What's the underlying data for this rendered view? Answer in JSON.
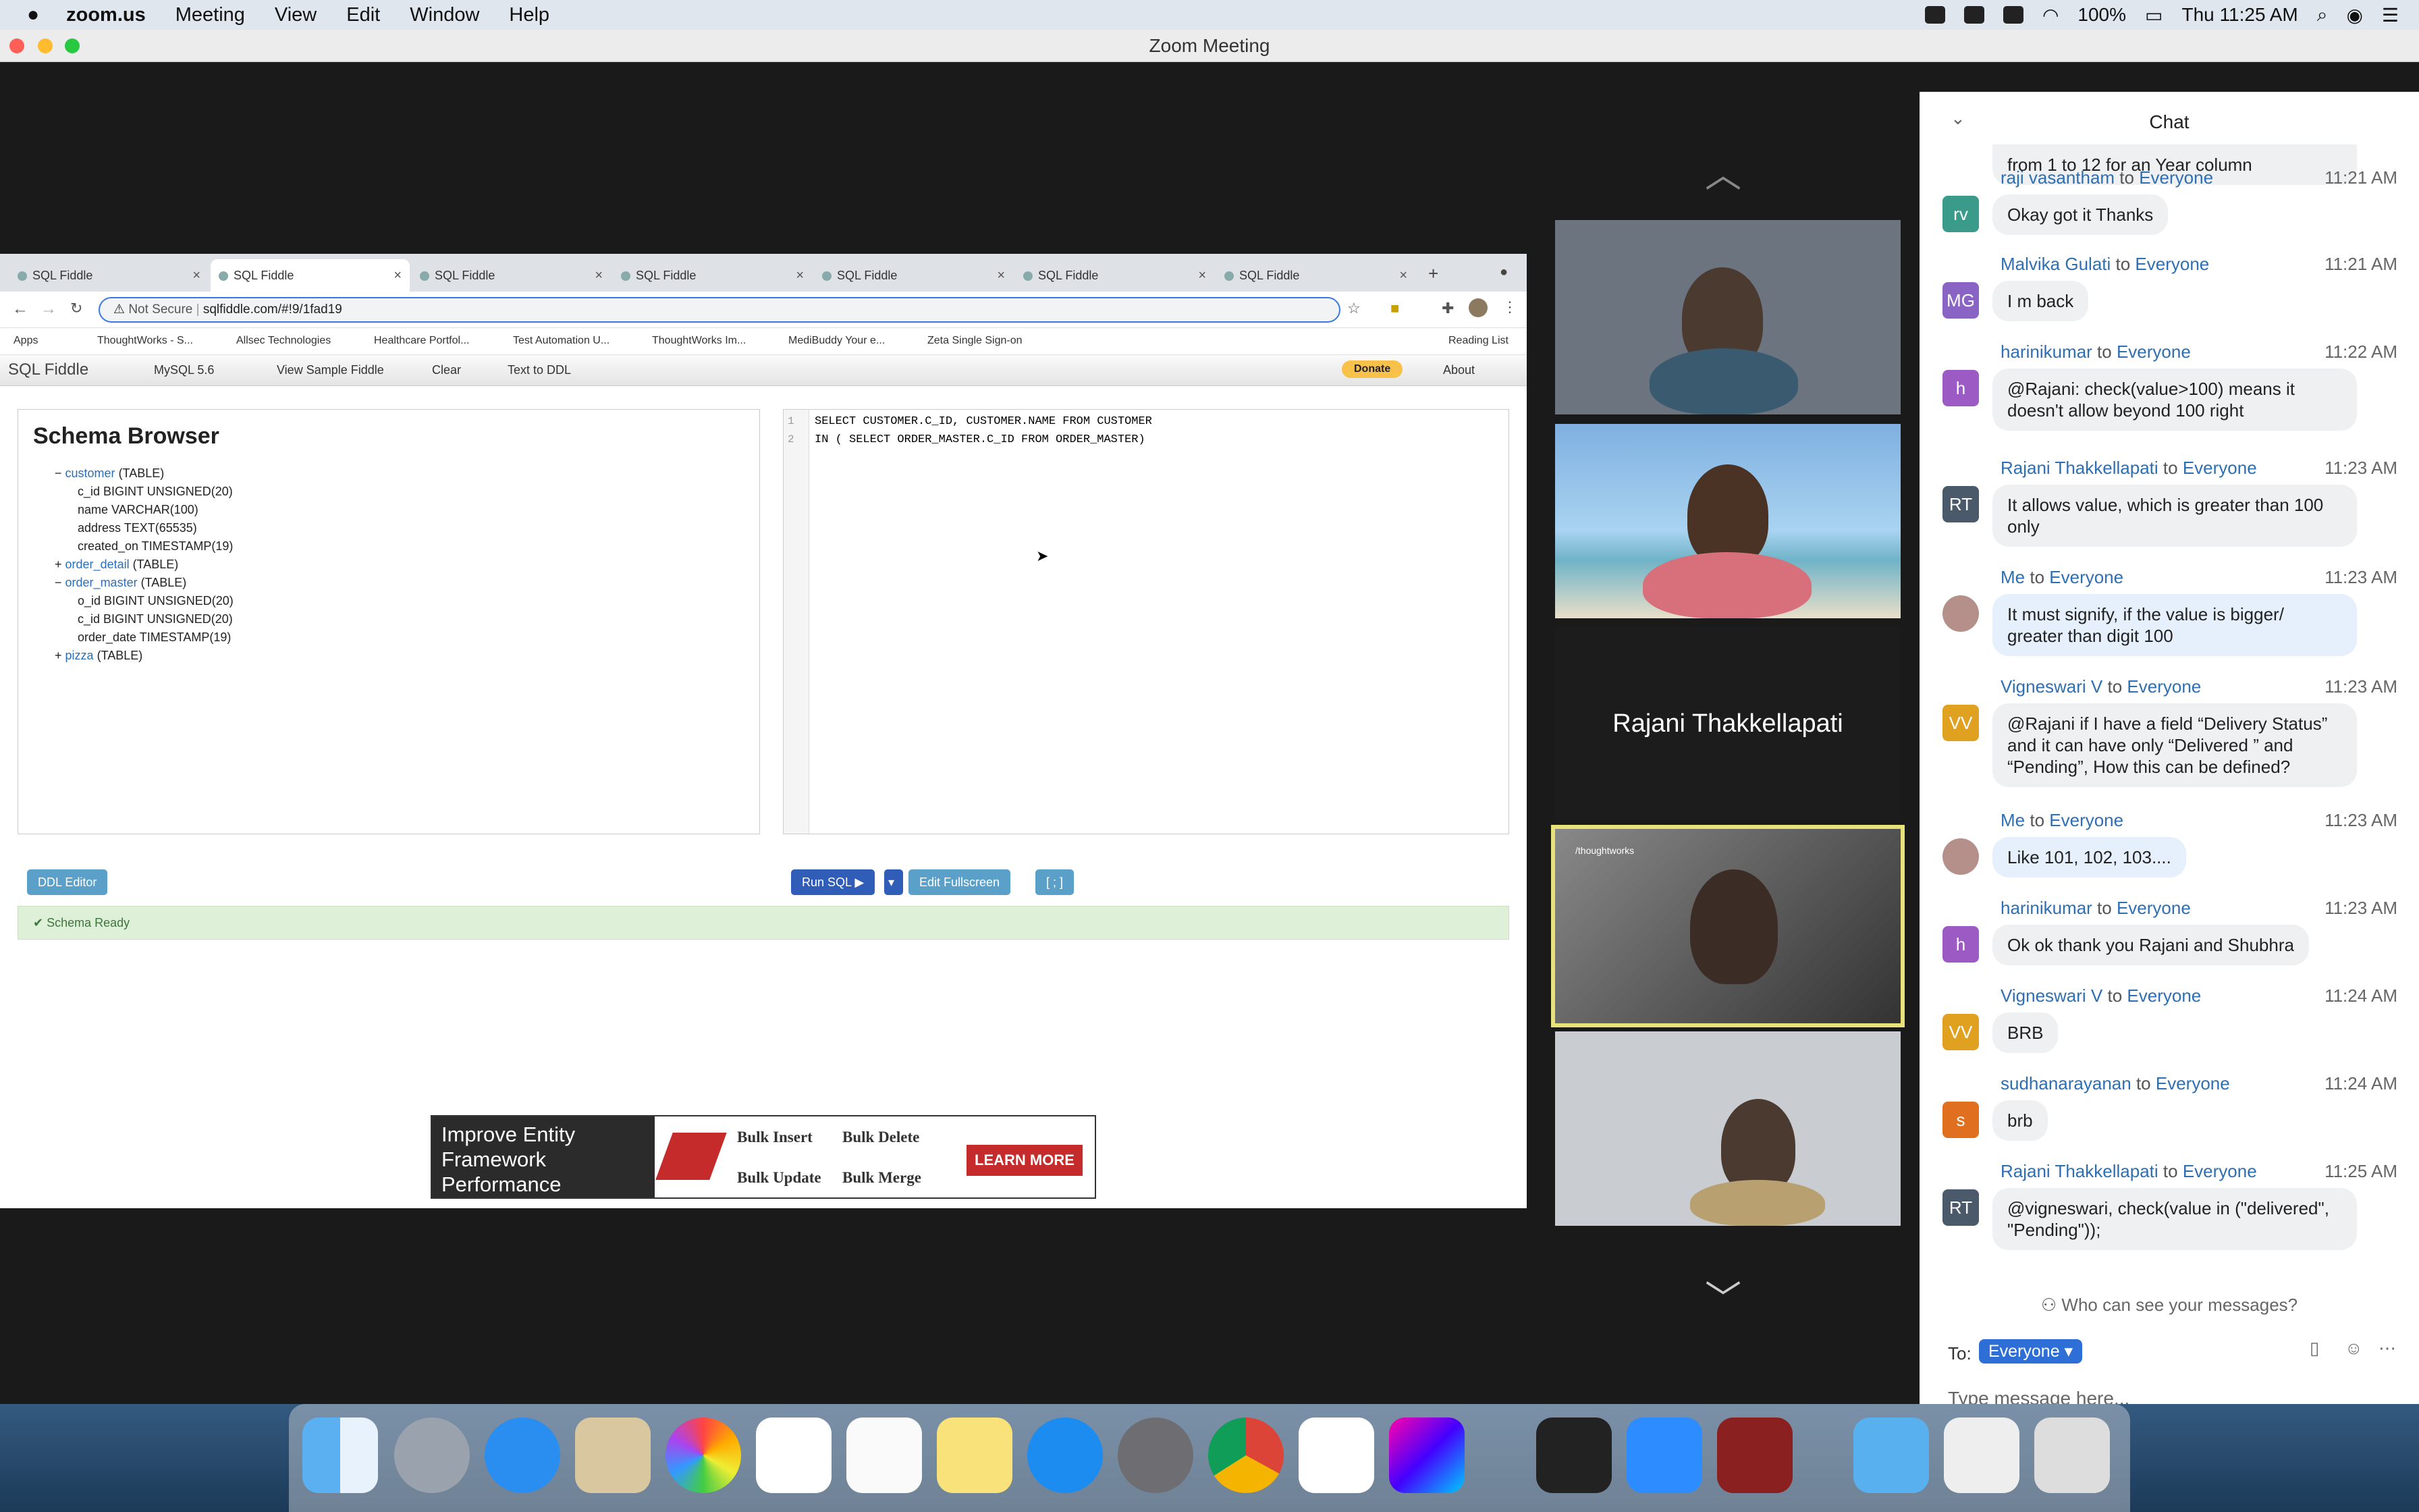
{
  "menubar": {
    "app": "zoom.us",
    "items": [
      "Meeting",
      "View",
      "Edit",
      "Window",
      "Help"
    ],
    "battery": "100%",
    "clock": "Thu 11:25 AM"
  },
  "window": {
    "title": "Zoom Meeting"
  },
  "browser": {
    "tabs": [
      "SQL Fiddle",
      "SQL Fiddle",
      "SQL Fiddle",
      "SQL Fiddle",
      "SQL Fiddle",
      "SQL Fiddle",
      "SQL Fiddle"
    ],
    "not_secure": "Not Secure",
    "url": "sqlfiddle.com/#!9/1fad19",
    "bookmarks": [
      "Apps",
      "ThoughtWorks - S...",
      "Allsec Technologies",
      "Healthcare Portfol...",
      "Test Automation U...",
      "ThoughtWorks Im...",
      "MediBuddy Your e...",
      "Zeta Single Sign-on",
      "Reading List"
    ]
  },
  "fiddle": {
    "logo": "SQL Fiddle",
    "db": "MySQL 5.6",
    "view_sample": "View Sample Fiddle",
    "clear": "Clear",
    "text_to_ddl": "Text to DDL",
    "donate": "Donate",
    "about": "About",
    "schema_title": "Schema Browser",
    "tree": [
      {
        "sign": "−",
        "name": "customer",
        "kind": "(TABLE)",
        "cols": [
          "c_id BIGINT UNSIGNED(20)",
          "name VARCHAR(100)",
          "address TEXT(65535)",
          "created_on TIMESTAMP(19)"
        ]
      },
      {
        "sign": "+",
        "name": "order_detail",
        "kind": "(TABLE)",
        "cols": []
      },
      {
        "sign": "−",
        "name": "order_master",
        "kind": "(TABLE)",
        "cols": [
          "o_id BIGINT UNSIGNED(20)",
          "c_id BIGINT UNSIGNED(20)",
          "order_date TIMESTAMP(19)"
        ]
      },
      {
        "sign": "+",
        "name": "pizza",
        "kind": "(TABLE)",
        "cols": []
      }
    ],
    "code": [
      "SELECT CUSTOMER.C_ID, CUSTOMER.NAME FROM CUSTOMER",
      "IN ( SELECT ORDER_MASTER.C_ID FROM ORDER_MASTER)"
    ],
    "ddl_editor": "DDL Editor",
    "run_sql": "Run SQL ▶",
    "edit_fullscreen": "Edit Fullscreen",
    "sep": "[ ; ]",
    "ready": "✔ Schema Ready"
  },
  "ad": {
    "headline": "Improve Entity Framework Performance",
    "opts": [
      "Bulk Insert",
      "Bulk Delete",
      "Bulk Update",
      "Bulk Merge"
    ],
    "cta": "LEARN MORE"
  },
  "video": {
    "speaker_name": "Rajani Thakkellapati",
    "brand": "/thoughtworks"
  },
  "chat": {
    "title": "Chat",
    "partial": "from 1 to 12 for an Year column",
    "messages": [
      {
        "initials": "rv",
        "color": "#3a9b8a",
        "from": "raji vasantham",
        "to": "Everyone",
        "time": "11:21 AM",
        "text": "Okay got it Thanks"
      },
      {
        "initials": "MG",
        "color": "#8a64c4",
        "from": "Malvika Gulati",
        "to": "Everyone",
        "time": "11:21 AM",
        "text": "I m back"
      },
      {
        "initials": "h",
        "color": "#9c5bc4",
        "from": "harinikumar",
        "to": "Everyone",
        "time": "11:22 AM",
        "text": "@Rajani: check(value>100) means it doesn't allow beyond 100 right"
      },
      {
        "initials": "RT",
        "color": "#4a5a6a",
        "from": "Rajani Thakkellapati",
        "to": "Everyone",
        "time": "11:23 AM",
        "text": "It allows value, which is greater than 100 only"
      },
      {
        "initials": "",
        "color": "#b58f8a",
        "from": "Me",
        "to": "Everyone",
        "time": "11:23 AM",
        "text": "It must signify, if the value is bigger/ greater than digit 100",
        "me": true
      },
      {
        "initials": "VV",
        "color": "#e0a020",
        "from": "Vigneswari V",
        "to": "Everyone",
        "time": "11:23 AM",
        "text": "@Rajani if I have a field “Delivery Status” and it can have only “Delivered ” and “Pending”, How this can be defined?"
      },
      {
        "initials": "",
        "color": "#b58f8a",
        "from": "Me",
        "to": "Everyone",
        "time": "11:23 AM",
        "text": "Like 101, 102, 103....",
        "me": true
      },
      {
        "initials": "h",
        "color": "#9c5bc4",
        "from": "harinikumar",
        "to": "Everyone",
        "time": "11:23 AM",
        "text": "Ok ok thank you Rajani and Shubhra"
      },
      {
        "initials": "VV",
        "color": "#e0a020",
        "from": "Vigneswari V",
        "to": "Everyone",
        "time": "11:24 AM",
        "text": "BRB"
      },
      {
        "initials": "s",
        "color": "#e07020",
        "from": "sudhanarayanan",
        "to": "Everyone",
        "time": "11:24 AM",
        "text": "brb"
      },
      {
        "initials": "RT",
        "color": "#4a5a6a",
        "from": "Rajani Thakkellapati",
        "to": "Everyone",
        "time": "11:25 AM",
        "text": "@vigneswari,  check(value in (\"delivered\", \"Pending\"));"
      }
    ],
    "who_can_see": "Who can see your messages?",
    "to_label": "To:",
    "recipient": "Everyone ▾",
    "placeholder": "Type message here..."
  },
  "colors": {
    "accent": "#2d6fd6",
    "speaker_border": "#e8e27b"
  }
}
